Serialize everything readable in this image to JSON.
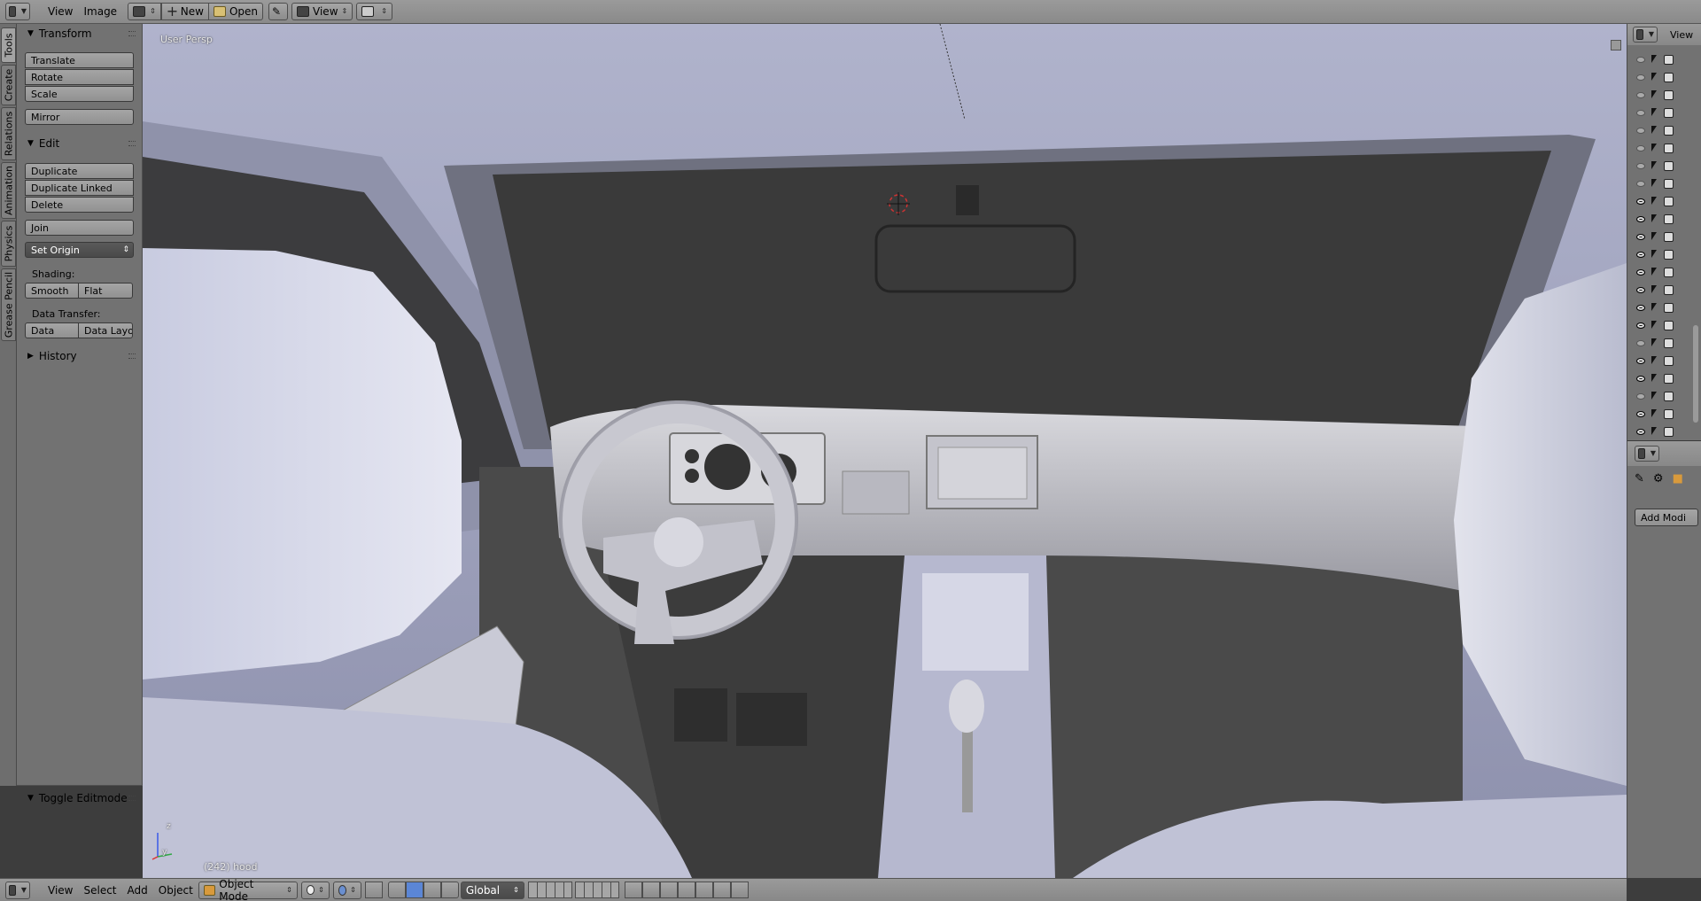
{
  "top_header": {
    "menus": [
      "View",
      "Image"
    ],
    "new_label": "New",
    "open_label": "Open",
    "view_label": "View"
  },
  "tabs": [
    "Tools",
    "Create",
    "Relations",
    "Animation",
    "Physics",
    "Grease Pencil"
  ],
  "tool_shelf": {
    "transform_title": "Transform",
    "translate": "Translate",
    "rotate": "Rotate",
    "scale": "Scale",
    "mirror": "Mirror",
    "edit_title": "Edit",
    "duplicate": "Duplicate",
    "duplicate_linked": "Duplicate Linked",
    "delete": "Delete",
    "join": "Join",
    "set_origin": "Set Origin",
    "shading_label": "Shading:",
    "smooth": "Smooth",
    "flat": "Flat",
    "data_transfer_label": "Data Transfer:",
    "data": "Data",
    "data_layout": "Data Layo",
    "history_title": "History",
    "toggle_editmode": "Toggle Editmode"
  },
  "viewport": {
    "view_label": "User Persp",
    "object_info": "(242) hood",
    "axis_z": "z",
    "axis_y": "y"
  },
  "bottom_header": {
    "menus": [
      "View",
      "Select",
      "Add",
      "Object"
    ],
    "mode": "Object Mode",
    "orientation": "Global"
  },
  "outliner": {
    "view_label": "View",
    "rows_visible": [
      false,
      false,
      false,
      false,
      false,
      false,
      false,
      false,
      true,
      true,
      true,
      true,
      true,
      true,
      true,
      true,
      false,
      true,
      true,
      false,
      true,
      true
    ]
  },
  "properties": {
    "add_modifier": "Add Modi"
  }
}
